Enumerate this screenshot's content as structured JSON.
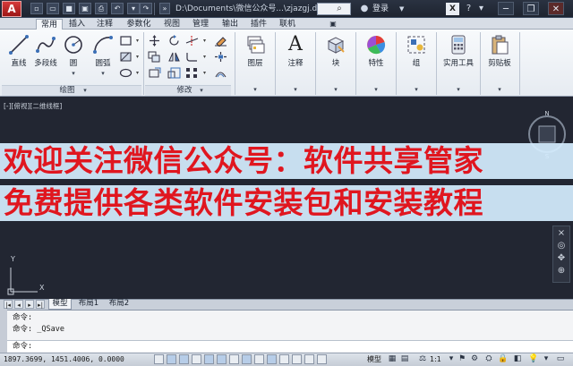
{
  "titlebar": {
    "app_logo": "A",
    "quick_access": [
      "new",
      "open",
      "save",
      "saveas",
      "print",
      "undo",
      "redo"
    ],
    "document_title": "D:\\Documents\\微信公众号...\\zjazgj.dwg",
    "login_label": "登录"
  },
  "tabs": [
    "常用",
    "插入",
    "注释",
    "参数化",
    "视图",
    "管理",
    "输出",
    "插件",
    "联机"
  ],
  "active_tab": "常用",
  "ribbon": {
    "draw_panel": {
      "title": "绘图",
      "tools": [
        {
          "label": "直线",
          "icon": "line-icon"
        },
        {
          "label": "多段线",
          "icon": "polyline-icon"
        },
        {
          "label": "圆",
          "icon": "circle-icon"
        },
        {
          "label": "圆弧",
          "icon": "arc-icon"
        }
      ]
    },
    "modify_panel": {
      "title": "修改"
    },
    "big_tools": [
      {
        "label": "图层",
        "icon": "layers-icon"
      },
      {
        "label": "注释",
        "icon": "annotation-icon"
      },
      {
        "label": "块",
        "icon": "block-icon"
      },
      {
        "label": "特性",
        "icon": "properties-icon"
      },
      {
        "label": "组",
        "icon": "group-icon"
      },
      {
        "label": "实用工具",
        "icon": "utilities-icon"
      },
      {
        "label": "剪贴板",
        "icon": "clipboard-icon"
      }
    ]
  },
  "viewport": {
    "label": "[-][俯视][二维线框]",
    "ucs_y": "Y",
    "ucs_x": "X"
  },
  "watermark": {
    "line1": "欢迎关注微信公众号：软件共享管家",
    "line2": "免费提供各类软件安装包和安装教程"
  },
  "layout_tabs": [
    "模型",
    "布局1",
    "布局2"
  ],
  "active_layout": "模型",
  "command": {
    "history": [
      "命令:",
      "命令: _QSave"
    ],
    "prompt": "命令:"
  },
  "statusbar": {
    "coords": "1897.3699, 1451.4006, 0.0000",
    "model_label": "模型",
    "scale": "1:1"
  },
  "colors": {
    "drawing_bg": "#222632",
    "title_bg": "#1e2430",
    "watermark_text": "#e0161f",
    "watermark_bg": "#d6eeff"
  }
}
